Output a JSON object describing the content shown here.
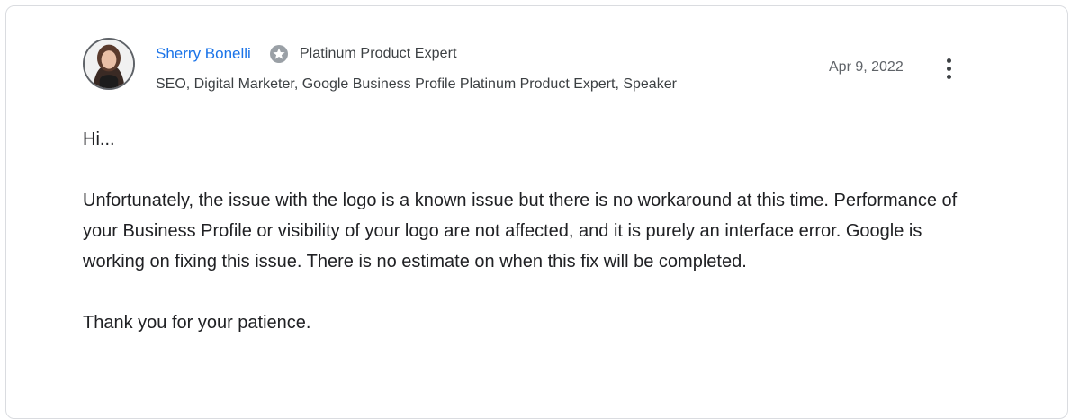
{
  "post": {
    "author": {
      "name": "Sherry Bonelli",
      "badge_icon": "platinum-star-icon",
      "badge": "Platinum Product Expert",
      "description": "SEO, Digital Marketer, Google Business Profile Platinum Product Expert, Speaker"
    },
    "date": "Apr 9, 2022",
    "more_icon": "more-vert-icon",
    "body": {
      "greeting": "Hi...",
      "paragraph": "Unfortunately, the issue with the logo is a known issue but there is no workaround at this time. Performance of your Business Profile or visibility of your logo are not affected, and it is purely an interface error. Google is working on fixing this issue. There is no estimate on when this fix will be completed.",
      "closing": "Thank you for your patience."
    }
  },
  "colors": {
    "link": "#1a73e8",
    "text": "#202124",
    "secondary_text": "#5f6368",
    "border": "#dadce0",
    "badge": "#9aa0a6"
  }
}
